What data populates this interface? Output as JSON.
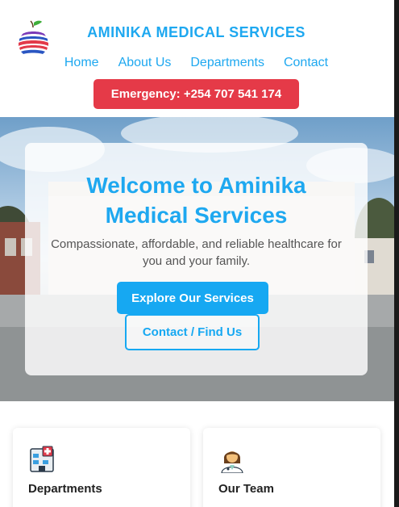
{
  "header": {
    "brand_title": "AMINIKA MEDICAL SERVICES",
    "nav": [
      {
        "label": "Home"
      },
      {
        "label": "About Us"
      },
      {
        "label": "Departments"
      },
      {
        "label": "Contact"
      }
    ],
    "emergency_label": "Emergency: +254 707 541 174"
  },
  "hero": {
    "title": "Welcome to Aminika Medical Services",
    "subtitle": "Compassionate, affordable, and reliable healthcare for you and your family.",
    "primary_button": "Explore Our Services",
    "secondary_button": "Contact / Find Us"
  },
  "cards": [
    {
      "title": "Departments",
      "icon": "hospital-icon"
    },
    {
      "title": "Our Team",
      "icon": "doctor-icon"
    }
  ],
  "colors": {
    "accent": "#1ea8f0",
    "emergency": "#e53a48"
  }
}
